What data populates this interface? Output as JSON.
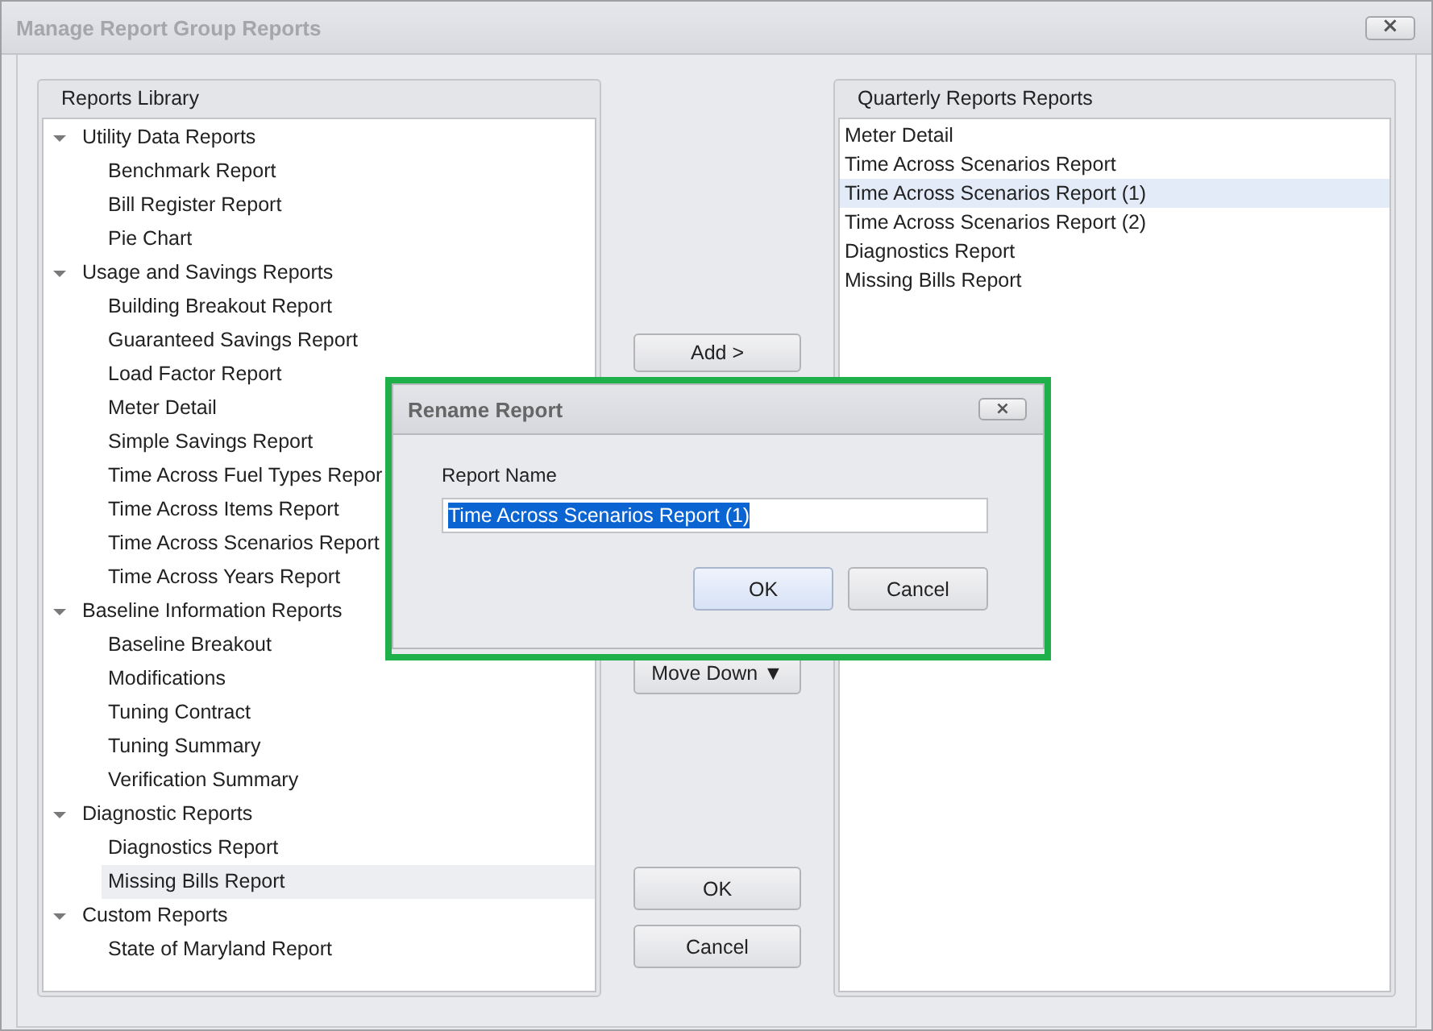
{
  "window": {
    "title": "Manage Report Group Reports",
    "close": "×"
  },
  "library": {
    "title": "Reports Library",
    "groups": [
      {
        "label": "Utility Data Reports",
        "expanded": true,
        "children": [
          {
            "label": "Benchmark Report",
            "selected": false
          },
          {
            "label": "Bill Register Report",
            "selected": false
          },
          {
            "label": "Pie Chart",
            "selected": false
          }
        ]
      },
      {
        "label": "Usage and Savings Reports",
        "expanded": true,
        "children": [
          {
            "label": "Building Breakout Report",
            "selected": false
          },
          {
            "label": "Guaranteed Savings Report",
            "selected": false
          },
          {
            "label": "Load Factor Report",
            "selected": false
          },
          {
            "label": "Meter Detail",
            "selected": false
          },
          {
            "label": "Simple Savings Report",
            "selected": false
          },
          {
            "label": "Time Across Fuel Types Repor",
            "selected": false
          },
          {
            "label": "Time Across Items Report",
            "selected": false
          },
          {
            "label": "Time Across Scenarios Report",
            "selected": false
          },
          {
            "label": "Time Across Years Report",
            "selected": false
          }
        ]
      },
      {
        "label": "Baseline Information Reports",
        "expanded": true,
        "children": [
          {
            "label": "Baseline Breakout",
            "selected": false
          },
          {
            "label": "Modifications",
            "selected": false
          },
          {
            "label": "Tuning Contract",
            "selected": false
          },
          {
            "label": "Tuning Summary",
            "selected": false
          },
          {
            "label": "Verification Summary",
            "selected": false
          }
        ]
      },
      {
        "label": "Diagnostic Reports",
        "expanded": true,
        "children": [
          {
            "label": "Diagnostics Report",
            "selected": false
          },
          {
            "label": "Missing Bills Report",
            "selected": true
          }
        ]
      },
      {
        "label": "Custom Reports",
        "expanded": true,
        "children": [
          {
            "label": "State of Maryland Report",
            "selected": false
          }
        ]
      }
    ]
  },
  "middle": {
    "add": "Add >",
    "move_down": "Move Down ▼",
    "ok": "OK",
    "cancel": "Cancel"
  },
  "group": {
    "title": "Quarterly Reports  Reports",
    "items": [
      {
        "label": "Meter Detail",
        "selected": false
      },
      {
        "label": "Time Across Scenarios Report",
        "selected": false
      },
      {
        "label": "Time Across Scenarios Report (1)",
        "selected": true
      },
      {
        "label": "Time Across Scenarios Report (2)",
        "selected": false
      },
      {
        "label": "Diagnostics Report",
        "selected": false
      },
      {
        "label": "Missing Bills Report",
        "selected": false
      }
    ]
  },
  "dialog": {
    "title": "Rename Report",
    "close": "×",
    "field_label": "Report Name",
    "value": "Time Across Scenarios Report (1)",
    "ok": "OK",
    "cancel": "Cancel"
  }
}
